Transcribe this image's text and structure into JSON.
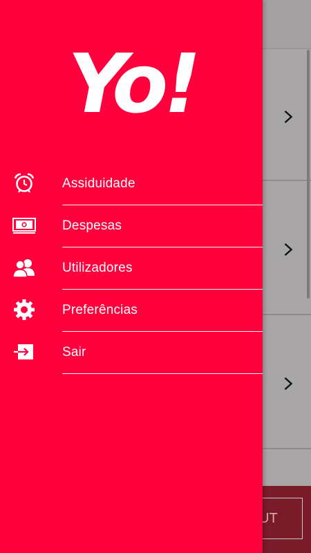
{
  "app": {
    "logo_text": "Yo!"
  },
  "drawer": {
    "items": [
      {
        "label": "Assiduidade",
        "icon": "alarm-clock-icon"
      },
      {
        "label": "Despesas",
        "icon": "money-bill-icon"
      },
      {
        "label": "Utilizadores",
        "icon": "users-icon"
      },
      {
        "label": "Preferências",
        "icon": "gear-icon"
      },
      {
        "label": "Sair",
        "icon": "sign-out-icon"
      }
    ]
  },
  "background": {
    "bottom_button_partial": "UT"
  },
  "colors": {
    "drawer": "#ff003c",
    "text": "#ffffff",
    "background_dim": "#a8a6a6"
  }
}
